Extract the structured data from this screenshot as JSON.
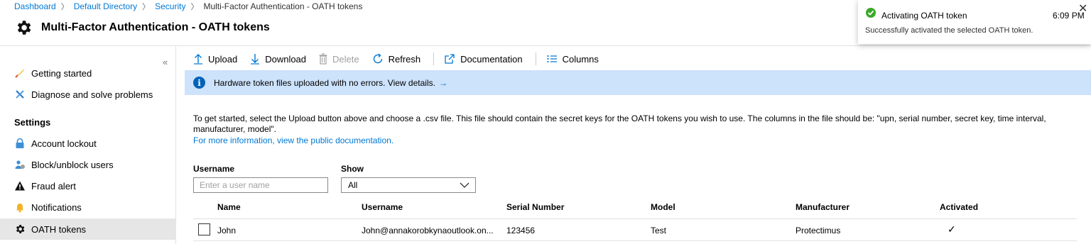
{
  "breadcrumb": {
    "items": [
      "Dashboard",
      "Default Directory",
      "Security"
    ],
    "current": "Multi-Factor Authentication - OATH tokens"
  },
  "page": {
    "title": "Multi-Factor Authentication - OATH tokens"
  },
  "sidebar": {
    "collapse": "«",
    "items": [
      {
        "label": "Getting started",
        "icon": "rocket-icon"
      },
      {
        "label": "Diagnose and solve problems",
        "icon": "tools-icon"
      }
    ],
    "section_heading": "Settings",
    "settings_items": [
      {
        "label": "Account lockout",
        "icon": "lock-icon"
      },
      {
        "label": "Block/unblock users",
        "icon": "users-icon"
      },
      {
        "label": "Fraud alert",
        "icon": "warning-icon"
      },
      {
        "label": "Notifications",
        "icon": "bell-icon"
      },
      {
        "label": "OATH tokens",
        "icon": "gear-icon",
        "active": true
      }
    ]
  },
  "toolbar": {
    "upload": "Upload",
    "download": "Download",
    "delete": "Delete",
    "refresh": "Refresh",
    "documentation": "Documentation",
    "columns": "Columns"
  },
  "banner": {
    "message": "Hardware token files uploaded with no errors. View details.",
    "arrow": "→"
  },
  "description": {
    "text": "To get started, select the Upload button above and choose a .csv file. This file should contain the secret keys for the OATH tokens you wish to use. The columns in the file should be: \"upn, serial number, secret key, time interval, manufacturer, model\".",
    "link": "For more information, view the public documentation."
  },
  "filters": {
    "username_label": "Username",
    "username_placeholder": "Enter a user name",
    "show_label": "Show",
    "show_value": "All"
  },
  "table": {
    "headers": [
      "Name",
      "Username",
      "Serial Number",
      "Model",
      "Manufacturer",
      "Activated"
    ],
    "rows": [
      {
        "name": "John",
        "username": "John@annakorobkynaoutlook.on...",
        "serial": "123456",
        "model": "Test",
        "manufacturer": "Protectimus",
        "activated": "✓"
      }
    ]
  },
  "toast": {
    "title": "Activating OATH token",
    "time": "6:09 PM",
    "message": "Successfully activated the selected OATH token.",
    "close": "✕"
  },
  "colors": {
    "link": "#0078d4",
    "banner_bg": "#cde2fb",
    "success": "#3aa92b",
    "active_nav": "#e6e6e6"
  }
}
